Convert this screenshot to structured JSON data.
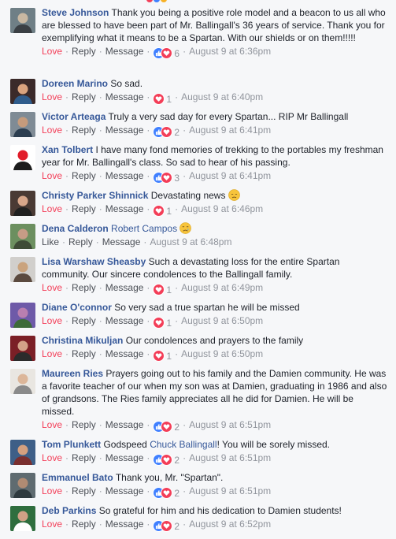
{
  "actions": {
    "love": "Love",
    "like": "Like",
    "reply": "Reply",
    "message": "Message"
  },
  "colors": {
    "accent_link": "#365899",
    "love": "#f33e58",
    "like": "#4080ff",
    "meta": "#90949c"
  },
  "comments": [
    {
      "author": "Steve Johnson",
      "text": "Thank you being a positive role model and a beacon to us all who are blessed to have been part of Mr. Ballingall's 36 years of service. Thank you for exemplifying what it means to be a Spartan. With our shields or on them!!!!!",
      "reaction": "Love",
      "react_icons": [
        "like-icon",
        "heart-icon"
      ],
      "count": "6",
      "time": "August 9 at 6:36pm"
    },
    {
      "author": "Doreen Marino",
      "text": "So sad.",
      "reaction": "Love",
      "react_icons": [
        "heart-icon"
      ],
      "count": "1",
      "time": "August 9 at 6:40pm"
    },
    {
      "author": "Victor Arteaga",
      "text": "Truly a very sad day for every Spartan... RIP Mr Ballingall",
      "reaction": "Love",
      "react_icons": [
        "like-icon",
        "heart-icon"
      ],
      "count": "2",
      "time": "August 9 at 6:41pm"
    },
    {
      "author": "Xan Tolbert",
      "text": "I have many fond memories of trekking to the portables my freshman year for Mr. Ballingall's class. So sad to hear of his passing.",
      "reaction": "Love",
      "react_icons": [
        "like-icon",
        "heart-icon"
      ],
      "count": "3",
      "time": "August 9 at 6:41pm"
    },
    {
      "author": "Christy Parker Shinnick",
      "text": "Devastating news",
      "emoji": "disappointed-face-emoji",
      "reaction": "Love",
      "react_icons": [
        "heart-icon"
      ],
      "count": "1",
      "time": "August 9 at 6:46pm"
    },
    {
      "author": "Dena Calderon",
      "mention": "Robert Campos",
      "text": "",
      "emoji": "crying-face-emoji",
      "reaction": "Like",
      "react_icons": [],
      "count": "",
      "time": "August 9 at 6:48pm"
    },
    {
      "author": "Lisa Warshaw Sheasby",
      "text": "Such a devastating loss for the entire Spartan community. Our sincere condolences to the Ballingall family.",
      "reaction": "Love",
      "react_icons": [
        "heart-icon"
      ],
      "count": "1",
      "time": "August 9 at 6:49pm"
    },
    {
      "author": "Diane O'connor",
      "text": "So very sad a true spartan he will be missed",
      "reaction": "Love",
      "react_icons": [
        "heart-icon"
      ],
      "count": "1",
      "time": "August 9 at 6:50pm"
    },
    {
      "author": "Christina Mikuljan",
      "text": "Our condolences and prayers to the family",
      "reaction": "Love",
      "react_icons": [
        "heart-icon"
      ],
      "count": "1",
      "time": "August 9 at 6:50pm"
    },
    {
      "author": "Maureen Ries",
      "text": "Prayers going out to his family and the Damien community. He was a favorite teacher of our when my son was at Damien, graduating in 1986 and also of grandsons. The Ries family appreciates all he did for Damien. He will be missed.",
      "reaction": "Love",
      "react_icons": [
        "like-icon",
        "heart-icon"
      ],
      "count": "2",
      "time": "August 9 at 6:51pm"
    },
    {
      "author": "Tom Plunkett",
      "text": "Godspeed",
      "mention": "Chuck Ballingall",
      "text_after": "! You will be sorely missed.",
      "reaction": "Love",
      "react_icons": [
        "like-icon",
        "heart-icon"
      ],
      "count": "2",
      "time": "August 9 at 6:51pm"
    },
    {
      "author": "Emmanuel Bato",
      "text": "Thank you, Mr. \"Spartan\".",
      "reaction": "Love",
      "react_icons": [
        "like-icon",
        "heart-icon"
      ],
      "count": "2",
      "time": "August 9 at 6:51pm"
    },
    {
      "author": "Deb Parkins",
      "text": "So grateful for him and his dedication to Damien students!",
      "reaction": "Love",
      "react_icons": [
        "like-icon",
        "heart-icon"
      ],
      "count": "2",
      "time": "August 9 at 6:52pm"
    }
  ]
}
